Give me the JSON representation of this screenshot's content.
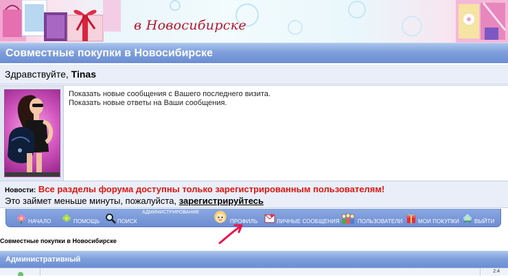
{
  "banner": {
    "subtitle": "в Новосибирске"
  },
  "header": {
    "title": "Совместные покупки в Новосибирске"
  },
  "greeting": {
    "prefix": "Здравствуйте, ",
    "username": "Tinas"
  },
  "panel": {
    "links": [
      "Показать новые сообщения с Вашего последнего визита.",
      "Показать новые ответы на Ваши сообщения."
    ]
  },
  "news": {
    "label": "Новости:",
    "text": "Все разделы форума доступны только зарегистрированным пользователям!",
    "line2_prefix": "Это займет меньше минуты, пожалуйста, ",
    "register_link": "зарегистрируйтесь"
  },
  "nav": {
    "admin_label": "АДМИНИСТРИРОВАНИЕ",
    "items": [
      {
        "label": "НАЧАЛО",
        "icon": "flower-icon"
      },
      {
        "label": "ПОМОЩЬ",
        "icon": "flower-icon"
      },
      {
        "label": "ПОИСК",
        "icon": "magnifier-icon"
      },
      {
        "label": "ПРОФИЛЬ",
        "icon": "face-icon"
      },
      {
        "label": "ЛИЧНЫЕ СООБЩЕНИЯ",
        "icon": "letter-icon"
      },
      {
        "label": "ПОЛЬЗОВАТЕЛИ",
        "icon": "users-icon"
      },
      {
        "label": "МОИ ПОКУПКИ",
        "icon": "gift-icon"
      },
      {
        "label": "ВЫЙТИ",
        "icon": "flower-icon"
      }
    ]
  },
  "breadcrumb": "Совместные покупки в Новосибирске",
  "section": {
    "title": "Административный"
  },
  "forum_row": {
    "time": "2:4"
  },
  "colors": {
    "header_blue": "#7f9fdb",
    "news_red": "#e0160f",
    "banner_text": "#b5152e",
    "arrow": "#e8144c"
  }
}
